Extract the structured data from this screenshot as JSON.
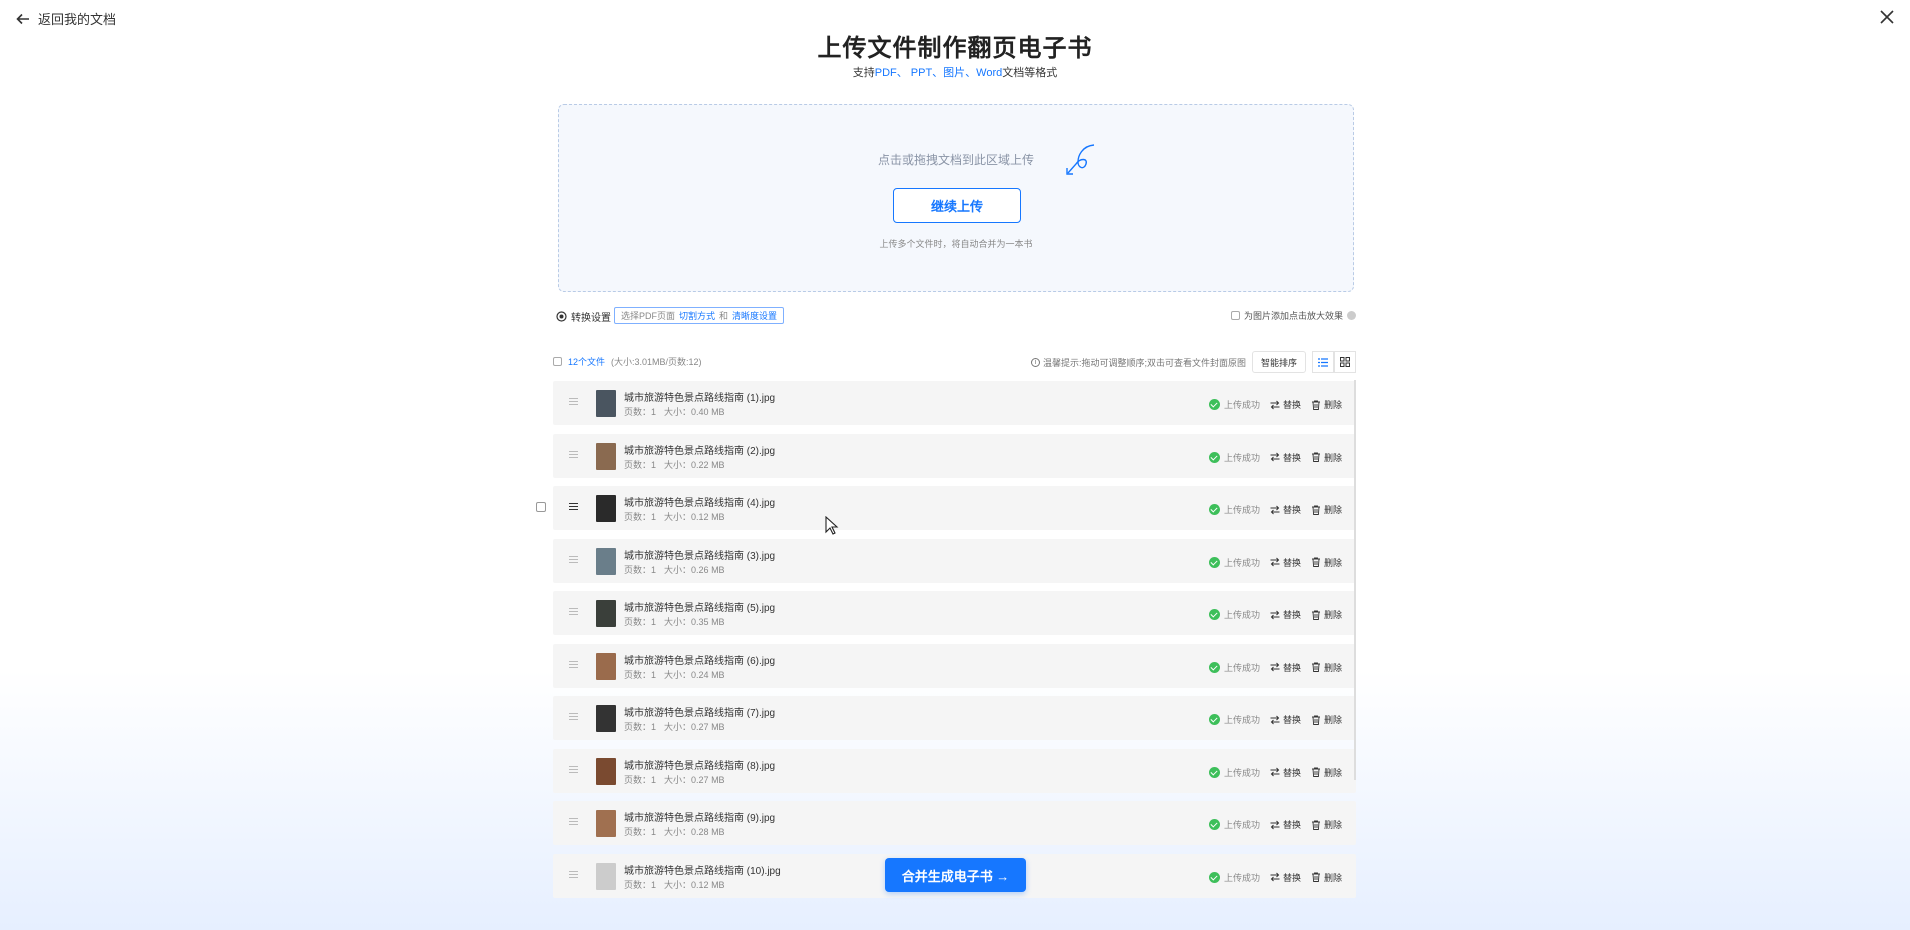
{
  "topbar": {
    "back_label": "返回我的文档"
  },
  "header": {
    "title": "上传文件制作翻页电子书",
    "subtitle_prefix": "支持",
    "subtitle_formats": "PDF、 PPT、图片、Word",
    "subtitle_suffix": "文档等格式"
  },
  "upload": {
    "hint": "点击或拖拽文档到此区域上传",
    "button_label": "继续上传",
    "note": "上传多个文件时，将自动合并为一本书"
  },
  "settings": {
    "label": "转换设置",
    "chip_prefix": "选择PDF页面",
    "chip_link1": "切割方式",
    "chip_and": "和",
    "chip_link2": "清晰度设置",
    "zoom_option": "为图片添加点击放大效果"
  },
  "list_header": {
    "count": "12个文件",
    "meta": "(大小:3.01MB/页数:12)",
    "tip": "温馨提示:拖动可调整顺序;双击可查看文件封面原图",
    "sort_label": "智能排序"
  },
  "row_labels": {
    "status": "上传成功",
    "replace": "替换",
    "delete": "删除",
    "pages_label": "页数：",
    "size_label": "大小："
  },
  "files": [
    {
      "name": "城市旅游特色景点路线指南 (1).jpg",
      "pages": "1",
      "size": "0.40 MB",
      "thumb_color": "#4a5560"
    },
    {
      "name": "城市旅游特色景点路线指南 (2).jpg",
      "pages": "1",
      "size": "0.22 MB",
      "thumb_color": "#8a6a50"
    },
    {
      "name": "城市旅游特色景点路线指南 (4).jpg",
      "pages": "1",
      "size": "0.12 MB",
      "thumb_color": "#2a2a2a"
    },
    {
      "name": "城市旅游特色景点路线指南 (3).jpg",
      "pages": "1",
      "size": "0.26 MB",
      "thumb_color": "#6a7e8a"
    },
    {
      "name": "城市旅游特色景点路线指南 (5).jpg",
      "pages": "1",
      "size": "0.35 MB",
      "thumb_color": "#3a3f3a"
    },
    {
      "name": "城市旅游特色景点路线指南 (6).jpg",
      "pages": "1",
      "size": "0.24 MB",
      "thumb_color": "#9a6b4c"
    },
    {
      "name": "城市旅游特色景点路线指南 (7).jpg",
      "pages": "1",
      "size": "0.27 MB",
      "thumb_color": "#333333"
    },
    {
      "name": "城市旅游特色景点路线指南 (8).jpg",
      "pages": "1",
      "size": "0.27 MB",
      "thumb_color": "#7a4a30"
    },
    {
      "name": "城市旅游特色景点路线指南 (9).jpg",
      "pages": "1",
      "size": "0.28 MB",
      "thumb_color": "#a07050"
    },
    {
      "name": "城市旅游特色景点路线指南 (10).jpg",
      "pages": "1",
      "size": "0.12 MB",
      "thumb_color": "#cccccc"
    }
  ],
  "footer": {
    "merge_label": "合并生成电子书 →"
  },
  "colors": {
    "accent": "#1677ff",
    "success": "#3dbf5a"
  }
}
